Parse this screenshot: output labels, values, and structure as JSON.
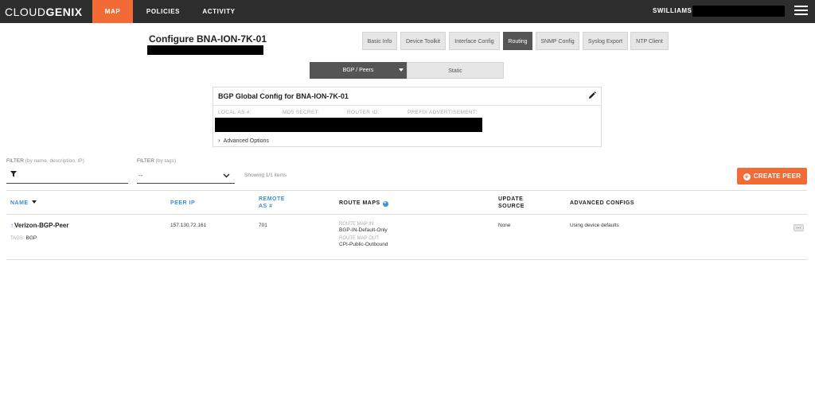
{
  "topnav": {
    "logo_light": "CLOUD",
    "logo_bold": "GENIX",
    "items": [
      {
        "label": "MAP"
      },
      {
        "label": "POLICIES"
      },
      {
        "label": "ACTIVITY"
      }
    ],
    "user": "SWILLIAMS",
    "accent_color": "#f26b36"
  },
  "header": {
    "title": "Configure BNA-ION-7K-01"
  },
  "tabs": [
    {
      "label": "Basic Info"
    },
    {
      "label": "Device Toolkit"
    },
    {
      "label": "Interface Config"
    },
    {
      "label": "Routing"
    },
    {
      "label": "SNMP Config"
    },
    {
      "label": "Syslog Export"
    },
    {
      "label": "NTP Client"
    }
  ],
  "segments": {
    "bgp_label": "BGP / Peers",
    "static_label": "Static"
  },
  "bgp_panel": {
    "title": "BGP Global Config for BNA-ION-7K-01",
    "labels": {
      "local_as": "LOCAL AS #:",
      "md5": "MD5 SECRET:",
      "router_id": "ROUTER ID:",
      "prefix": "PREFIX ADVERTISEMENT:"
    },
    "advanced_options": "Advanced Options"
  },
  "filters": {
    "filter1_label": "FILTER",
    "filter1_hint": "(by name, description, IP)",
    "filter2_label": "FILTER",
    "filter2_hint": "(by tags)",
    "tags_value": "--",
    "showing_text": "Showing 1/1 items"
  },
  "create_peer_label": "CREATE PEER",
  "table": {
    "headers": {
      "name": "NAME",
      "peer_ip": "PEER IP",
      "remote_as_1": "REMOTE",
      "remote_as_2": "AS #",
      "route_maps": "ROUTE MAPS",
      "update_source_1": "UPDATE",
      "update_source_2": "SOURCE",
      "advanced": "ADVANCED CONFIGS"
    },
    "rows": [
      {
        "name": "Verizon-BGP-Peer",
        "tags_label": "TAGS:",
        "tags_value": "BGP",
        "peer_ip": "157.130.72.161",
        "remote_as": "701",
        "route_map_in_label": "ROUTE MAP IN:",
        "route_map_in": "BGP-IN-Default-Only",
        "route_map_out_label": "ROUTE MAP OUT:",
        "route_map_out": "CPI-Public-Outbound",
        "update_source": "None",
        "advanced": "Using device defaults",
        "menu": "..."
      }
    ]
  }
}
